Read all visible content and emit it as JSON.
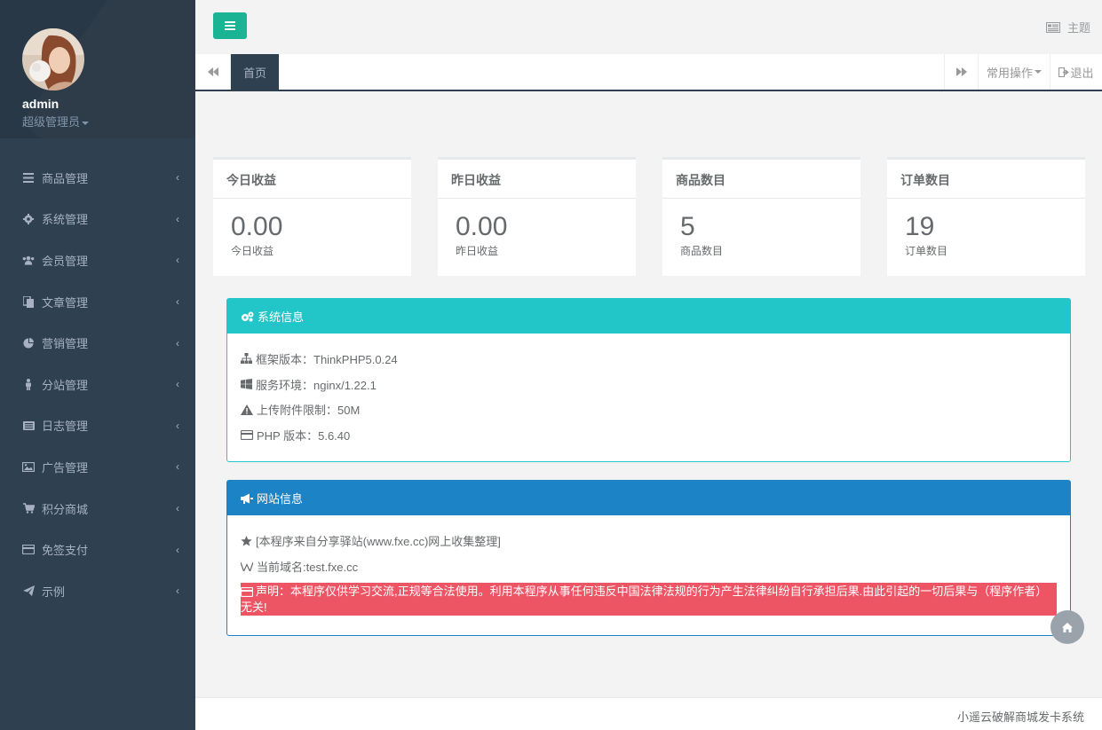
{
  "user": {
    "name": "admin",
    "role": "超级管理员"
  },
  "sidebar": {
    "items": [
      {
        "label": "商品管理",
        "icon": "bars-icon"
      },
      {
        "label": "系统管理",
        "icon": "gear-icon"
      },
      {
        "label": "会员管理",
        "icon": "users-icon"
      },
      {
        "label": "文章管理",
        "icon": "files-icon"
      },
      {
        "label": "营销管理",
        "icon": "pie-chart-icon"
      },
      {
        "label": "分站管理",
        "icon": "male-icon"
      },
      {
        "label": "日志管理",
        "icon": "list-icon"
      },
      {
        "label": "广告管理",
        "icon": "image-icon"
      },
      {
        "label": "积分商城",
        "icon": "cart-icon"
      },
      {
        "label": "免签支付",
        "icon": "credit-card-icon"
      },
      {
        "label": "示例",
        "icon": "paper-plane-icon"
      }
    ]
  },
  "topbar": {
    "theme_label": "主题"
  },
  "tabs": {
    "active": "首页",
    "ops_label": "常用操作",
    "logout_label": "退出"
  },
  "stats": [
    {
      "title": "今日收益",
      "value": "0.00",
      "sub": "今日收益"
    },
    {
      "title": "昨日收益",
      "value": "0.00",
      "sub": "昨日收益"
    },
    {
      "title": "商品数目",
      "value": "5",
      "sub": "商品数目"
    },
    {
      "title": "订单数目",
      "value": "19",
      "sub": "订单数目"
    }
  ],
  "system_info": {
    "title": "系统信息",
    "lines": [
      "框架版本：ThinkPHP5.0.24",
      "服务环境：nginx/1.22.1",
      "上传附件限制：50M",
      "PHP 版本：5.6.40"
    ]
  },
  "site_info": {
    "title": "网站信息",
    "source": "[本程序来自分享驿站(www.fxe.cc)网上收集整理]",
    "domain": "当前域名:test.fxe.cc",
    "disclaimer": "声明：本程序仅供学习交流,正规等合法使用。利用本程序从事任何违反中国法律法规的行为产生法律纠纷自行承担后果.由此引起的一切后果与（程序作者）无关!"
  },
  "footer": {
    "text": "小遥云破解商城发卡系统"
  },
  "colors": {
    "sidebar": "#2f4050",
    "primary": "#1ab394",
    "info": "#23c6c8",
    "success": "#1c84c6",
    "danger": "#ed5565"
  }
}
